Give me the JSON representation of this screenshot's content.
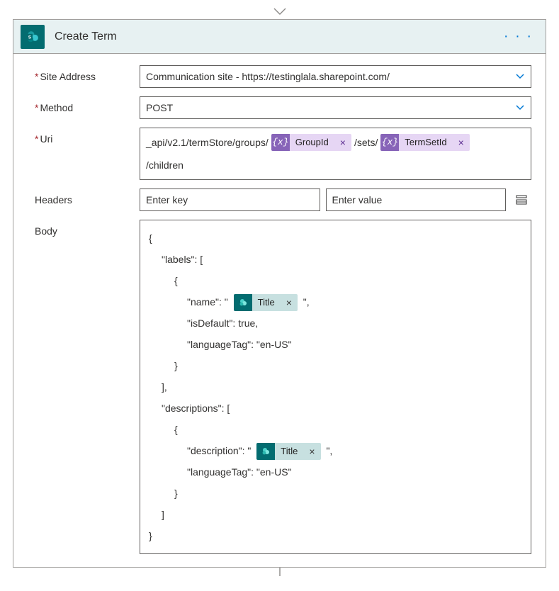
{
  "header": {
    "title": "Create Term"
  },
  "fields": {
    "site_address": {
      "label": "Site Address",
      "value": "Communication site - https://testinglala.sharepoint.com/"
    },
    "method": {
      "label": "Method",
      "value": "POST"
    },
    "uri": {
      "label": "Uri",
      "seg1": "_api/v2.1/termStore/groups/",
      "pill1": "GroupId",
      "seg2": "/sets/",
      "pill2": "TermSetId",
      "seg3": "/children"
    },
    "headers": {
      "label": "Headers",
      "key_placeholder": "Enter key",
      "value_placeholder": "Enter value"
    },
    "body": {
      "label": "Body",
      "l1": "{",
      "l2": "\"labels\": [",
      "l3": "{",
      "l4a": "\"name\": \"",
      "l4pill": "Title",
      "l4b": "\",",
      "l5": "\"isDefault\": true,",
      "l6": "\"languageTag\": \"en-US\"",
      "l7": "}",
      "l8": "],",
      "l9": "\"descriptions\": [",
      "l10": "{",
      "l11a": "\"description\": \"",
      "l11pill": "Title",
      "l11b": "\",",
      "l12": "\"languageTag\": \"en-US\"",
      "l13": "}",
      "l14": "]",
      "l15": "}"
    }
  },
  "glyphs": {
    "x": "×",
    "fx": "{x}",
    "dots": "· · ·"
  }
}
